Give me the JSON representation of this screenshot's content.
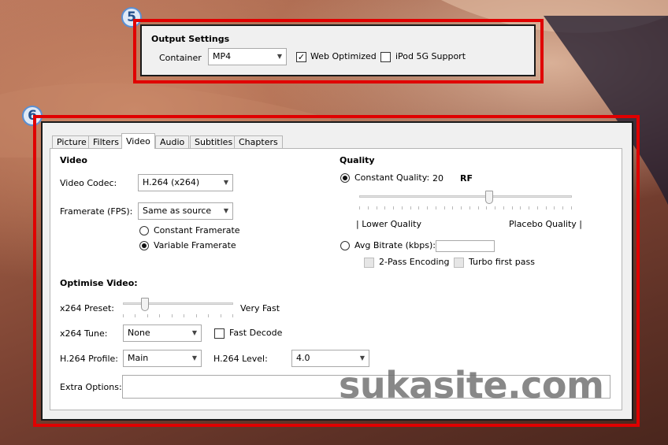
{
  "badges": {
    "output": "5",
    "video": "6"
  },
  "output_settings": {
    "title": "Output Settings",
    "container_label": "Container",
    "container_value": "MP4",
    "web_optimized_label": "Web Optimized",
    "web_optimized_checked": true,
    "ipod_label": "iPod 5G Support",
    "ipod_checked": false
  },
  "tabs": [
    {
      "label": "Picture",
      "active": false
    },
    {
      "label": "Filters",
      "active": false
    },
    {
      "label": "Video",
      "active": true
    },
    {
      "label": "Audio",
      "active": false
    },
    {
      "label": "Subtitles",
      "active": false
    },
    {
      "label": "Chapters",
      "active": false
    }
  ],
  "video": {
    "section_title": "Video",
    "codec_label": "Video Codec:",
    "codec_value": "H.264 (x264)",
    "framerate_label": "Framerate (FPS):",
    "framerate_value": "Same as source",
    "constant_framerate_label": "Constant Framerate",
    "variable_framerate_label": "Variable Framerate",
    "framerate_mode": "variable"
  },
  "quality": {
    "section_title": "Quality",
    "constant_quality_label": "Constant Quality:",
    "rf_value": "20",
    "rf_unit": "RF",
    "slider_level": 0.61,
    "lower_label": "| Lower Quality",
    "placebo_label": "Placebo Quality |",
    "avg_bitrate_label": "Avg Bitrate (kbps):",
    "avg_bitrate_value": "",
    "two_pass_label": "2-Pass Encoding",
    "turbo_label": "Turbo first pass",
    "mode": "constant"
  },
  "optimise": {
    "section_title": "Optimise Video:",
    "preset_label": "x264 Preset:",
    "preset_value": "Very Fast",
    "preset_level": 0.2,
    "tune_label": "x264 Tune:",
    "tune_value": "None",
    "fast_decode_label": "Fast Decode",
    "fast_decode_checked": false,
    "profile_label": "H.264 Profile:",
    "profile_value": "Main",
    "level_label": "H.264 Level:",
    "level_value": "4.0",
    "extra_label": "Extra Options:",
    "extra_value": ""
  },
  "watermark": "sukasite.com",
  "icons": {
    "dropdown": "chevron-down-icon",
    "check": "checkmark-icon"
  },
  "colors": {
    "highlight": "#e00000",
    "badge_border": "#5a8fd2",
    "window_bg": "#f0f0f0"
  }
}
